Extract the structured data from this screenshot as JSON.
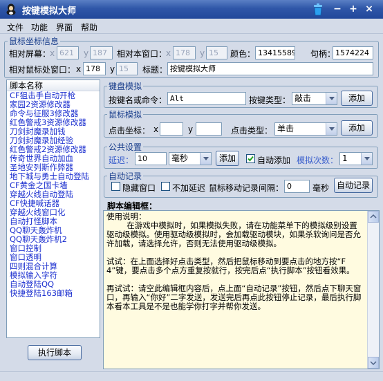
{
  "window": {
    "title": "按键模拟大师"
  },
  "menu": [
    "文件",
    "功能",
    "界面",
    "帮助"
  ],
  "mouse_info": {
    "legend": "鼠标坐标信息",
    "rel_screen_label": "相对屏幕：",
    "rel_screen_x": "621",
    "rel_screen_y": "187",
    "rel_window_label": "相对本窗口：",
    "rel_window_x": "178",
    "rel_window_y": "15",
    "color_label": "颜色：",
    "color_value": "13415589",
    "handle_label": "句柄：",
    "handle_value": "1574224",
    "rel_mouse_win_label": "相对鼠标处窗口：",
    "rel_mouse_win_x": "178",
    "rel_mouse_win_y": "15",
    "title_label": "标题：",
    "title_value": "按键模拟大师",
    "x": "x",
    "y": "y"
  },
  "script_list": {
    "header": "脚本名称",
    "items": [
      "CF狙击手自动开枪",
      "家园2资源修改器",
      "命令与征服3修改器",
      "红色警戒3资源修改器",
      "刀剑封魔录加钱",
      "刀剑封魔录加经验",
      "红色警戒2资源修改器",
      "传奇世界自动加血",
      "圣地安列斯作弊器",
      "地下城与勇士自动登陆",
      "CF黄金之国卡墙",
      "穿越火线自动登陆",
      "CF快捷喊话器",
      "穿越火线窗口化",
      "自动打怪脚本",
      "QQ聊天轰炸机",
      "QQ聊天轰炸机2",
      "窗口控制",
      "窗口透明",
      "四则混合计算",
      "模拟输入字符",
      "自动登陆QQ",
      "快捷登陆163邮箱"
    ],
    "run_button": "执行脚本"
  },
  "keyboard": {
    "legend": "键盘模拟",
    "key_label": "按键名或命令：",
    "key_value": "Alt",
    "type_label": "按键类型：",
    "type_value": "敲击",
    "add_button": "添加"
  },
  "mouse_sim": {
    "legend": "鼠标模拟",
    "coord_label": "点击坐标：",
    "x_label": "x",
    "y_label": "y",
    "x_value": "",
    "y_value": "",
    "type_label": "点击类型：",
    "type_value": "单击",
    "add_button": "添加"
  },
  "common": {
    "legend": "公共设置",
    "delay_label": "延迟：",
    "delay_value": "10",
    "unit_value": "毫秒",
    "add_button": "添加",
    "auto_add_label": "自动添加",
    "auto_add_checked": true,
    "repeat_label": "模拟次数：",
    "repeat_value": "1"
  },
  "auto_record": {
    "legend": "自动记录",
    "hide_window_label": "隐藏窗口",
    "no_delay_label": "不加延迟",
    "interval_label": "鼠标移动记录间隔：",
    "interval_value": "0",
    "interval_unit": "毫秒",
    "record_button": "自动记录"
  },
  "editor": {
    "title": "脚本编辑框：",
    "content": "使用说明：\n        在游戏中模拟时，如果模拟失败，请在功能菜单下的模拟级别设置驱动级模拟。使用驱动级模拟时，会加载驱动模块，如果杀软询问是否允许加载，请选择允许，否则无法使用驱动级模拟。\n\n试试：在上面选择好点击类型，然后把鼠标移动到要点击的地方按“F4”键，要点击多个点方重复按就行，按完后点“执行脚本”按钮看效果。\n\n再试试：请空此编辑框内容后，点上面“自动记录”按钮，然后点下聊天窗口，再输入“你好”二字发送，发送完后再点此按钮停止记录，最后执行脚本看本工具是不是也能学你打字并帮你发送。"
  }
}
